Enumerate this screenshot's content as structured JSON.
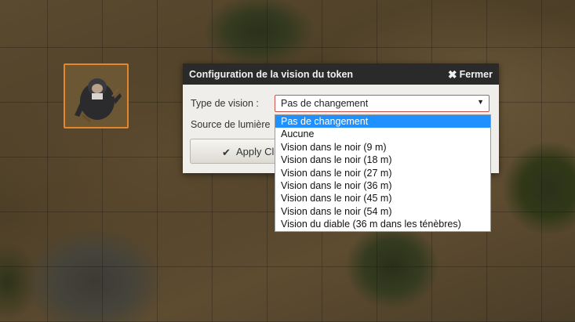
{
  "dialog": {
    "title": "Configuration de la vision du token",
    "close_label": "Fermer",
    "vision_label": "Type de vision :",
    "light_label": "Source de lumière",
    "apply_label": "Apply Cl"
  },
  "vision_select": {
    "value": "Pas de changement",
    "options": [
      "Pas de changement",
      "Aucune",
      "Vision dans le noir (9 m)",
      "Vision dans le noir (18 m)",
      "Vision dans le noir (27 m)",
      "Vision dans le noir (36 m)",
      "Vision dans le noir (45 m)",
      "Vision dans le noir (54 m)",
      "Vision du diable (36 m dans les ténèbres)"
    ],
    "highlighted_index": 0
  },
  "icons": {
    "close": "close-icon",
    "check": "check-icon",
    "arrow": "chevron-down-icon"
  },
  "colors": {
    "token_border": "#e8842a",
    "highlight": "#1e90ff",
    "select_border": "#c9574e",
    "header_bg": "#2a2a2a"
  }
}
